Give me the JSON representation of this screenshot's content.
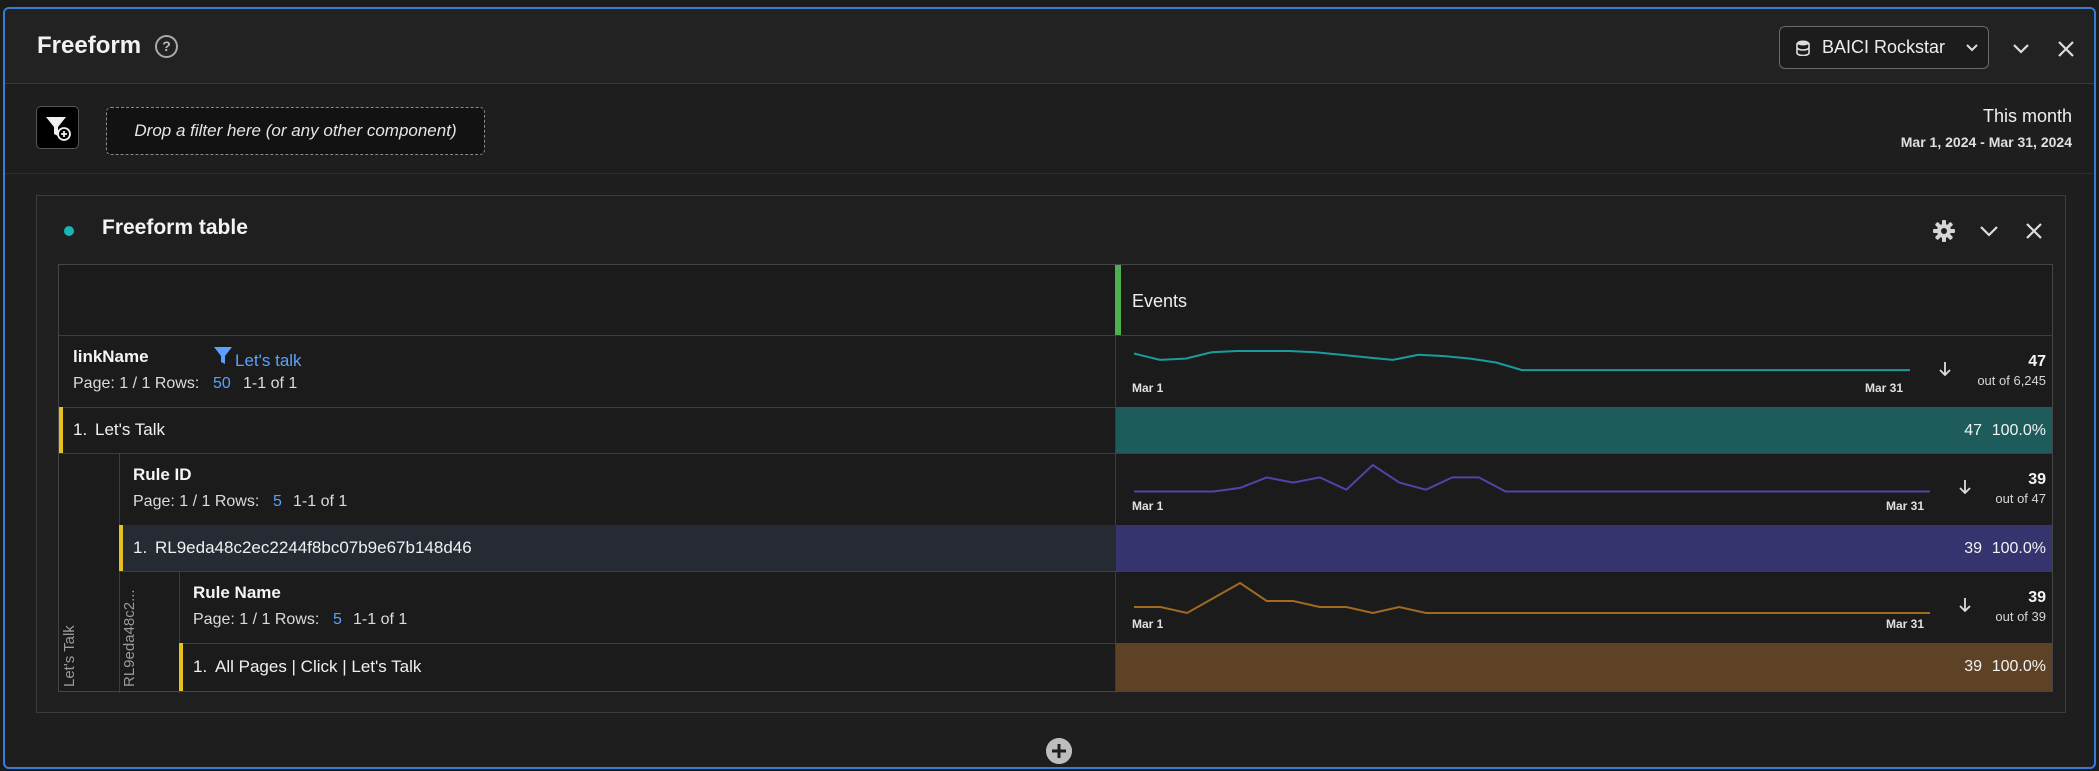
{
  "header": {
    "title": "Freeform",
    "help_icon": "?",
    "report_suite": "BAICI Rockstar"
  },
  "filter_bar": {
    "drop_hint": "Drop a filter here (or any other component)",
    "date_title": "This month",
    "date_range": "Mar 1, 2024 - Mar 31, 2024"
  },
  "table_panel": {
    "title": "Freeform table",
    "accent_color": "#1ab5b5",
    "metric_column": "Events",
    "dimensions": [
      {
        "name": "linkName",
        "filter_label": "Let's talk",
        "page_label": "Page: 1 / 1 Rows:",
        "rows_value": "50",
        "range": "1-1 of 1",
        "spark_start": "Mar 1",
        "spark_end": "Mar 31",
        "total": "47",
        "total_sub": "out of 6,245",
        "spark_color": "#1a9c9c",
        "spark_values": [
          40,
          30,
          32,
          42,
          44,
          44,
          44,
          42,
          38,
          34,
          30,
          38,
          36,
          32,
          26,
          14,
          14,
          14,
          14,
          14,
          14,
          14,
          14,
          14,
          14,
          14,
          14,
          14,
          14,
          14,
          14
        ],
        "row": {
          "index": "1.",
          "label": "Let's Talk",
          "value": "47",
          "percent": "100.0%",
          "fill_fraction": 1.0,
          "color": "#1e5c5c"
        }
      },
      {
        "name": "Rule ID",
        "page_label": "Page: 1 / 1 Rows:",
        "rows_value": "5",
        "range": "1-1 of 1",
        "spark_start": "Mar 1",
        "spark_end": "Mar 31",
        "total": "39",
        "total_sub": "out of 47",
        "spark_color": "#4d46a8",
        "spark_values": [
          4,
          4,
          4,
          4,
          8,
          20,
          14,
          20,
          6,
          34,
          14,
          6,
          20,
          20,
          4,
          4,
          4,
          4,
          4,
          4,
          4,
          4,
          4,
          4,
          4,
          4,
          4,
          4,
          4,
          4,
          4
        ],
        "row": {
          "index": "1.",
          "label": "RL9eda48c2ec2244f8bc07b9e67b148d46",
          "value": "39",
          "percent": "100.0%",
          "fill_fraction": 1.0,
          "color": "#35346e"
        }
      },
      {
        "name": "Rule Name",
        "page_label": "Page: 1 / 1 Rows:",
        "rows_value": "5",
        "range": "1-1 of 1",
        "spark_start": "Mar 1",
        "spark_end": "Mar 31",
        "total": "39",
        "total_sub": "out of 39",
        "spark_color": "#a06a22",
        "spark_values": [
          4,
          4,
          0,
          10,
          20,
          8,
          8,
          4,
          4,
          0,
          4,
          0,
          0,
          0,
          0,
          0,
          0,
          0,
          0,
          0,
          0,
          0,
          0,
          0,
          0,
          0,
          0,
          0,
          0,
          0,
          0
        ],
        "row": {
          "index": "1.",
          "label": "All Pages | Click | Let's Talk",
          "value": "39",
          "percent": "100.0%",
          "fill_fraction": 1.0,
          "color": "#5e4225"
        }
      }
    ],
    "vertical_labels": {
      "outer": "Let's Talk",
      "inner": "RL9eda48c2..."
    }
  },
  "icons": {
    "help": "question-circle-icon",
    "report_suite": "database-icon",
    "filter": "filter-add-icon",
    "settings": "gear-icon",
    "collapse": "chevron-down-icon",
    "close": "close-icon",
    "sort": "arrow-down-icon",
    "add": "plus-circle-icon"
  }
}
